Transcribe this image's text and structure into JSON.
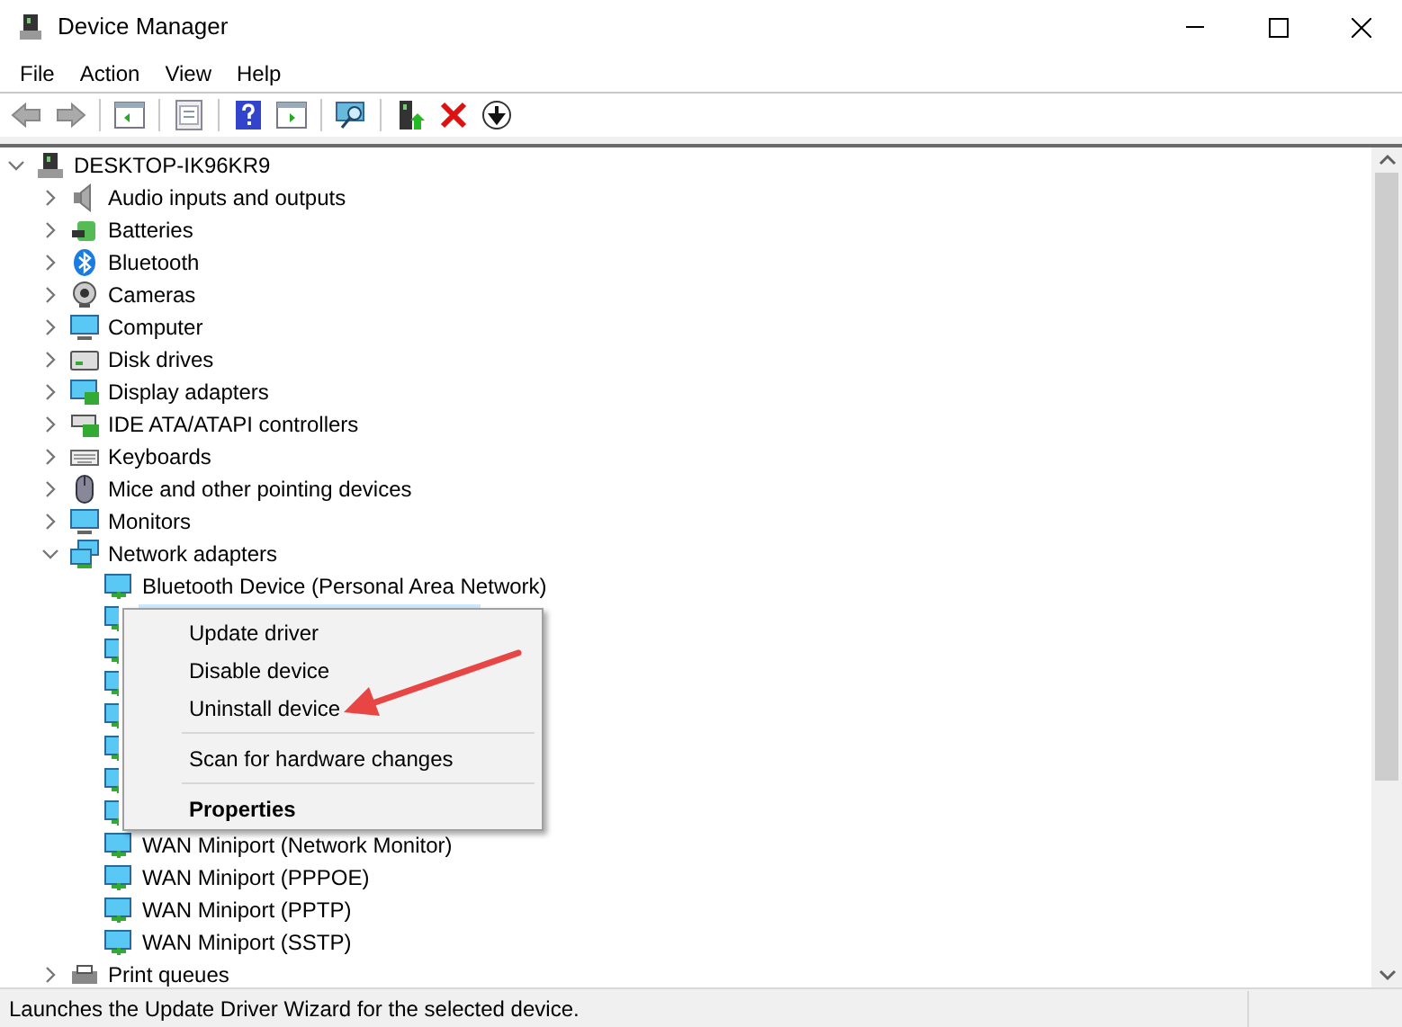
{
  "window": {
    "title": "Device Manager"
  },
  "menu_bar": [
    "File",
    "Action",
    "View",
    "Help"
  ],
  "tree": {
    "label": "DESKTOP-IK96KR9",
    "expanded": true,
    "selected": false,
    "children": [
      {
        "label": "Audio inputs and outputs",
        "expanded": false,
        "selected": false
      },
      {
        "label": "Batteries",
        "expanded": false,
        "selected": false
      },
      {
        "label": "Bluetooth",
        "expanded": false,
        "selected": false
      },
      {
        "label": "Cameras",
        "expanded": false,
        "selected": false
      },
      {
        "label": "Computer",
        "expanded": false,
        "selected": false
      },
      {
        "label": "Disk drives",
        "expanded": false,
        "selected": false
      },
      {
        "label": "Display adapters",
        "expanded": false,
        "selected": false
      },
      {
        "label": "IDE ATA/ATAPI controllers",
        "expanded": false,
        "selected": false
      },
      {
        "label": "Keyboards",
        "expanded": false,
        "selected": false
      },
      {
        "label": "Mice and other pointing devices",
        "expanded": false,
        "selected": false
      },
      {
        "label": "Monitors",
        "expanded": false,
        "selected": false
      },
      {
        "label": "Network adapters",
        "expanded": true,
        "selected": false,
        "children": [
          {
            "kind": "shown",
            "label": "Bluetooth Device (Personal Area Network)",
            "selected": false
          },
          {
            "kind": "covered",
            "selected": true
          },
          {
            "kind": "covered"
          },
          {
            "kind": "covered"
          },
          {
            "kind": "covered"
          },
          {
            "kind": "covered"
          },
          {
            "kind": "covered"
          },
          {
            "kind": "covered"
          },
          {
            "kind": "shown",
            "label": "WAN Miniport (Network Monitor)",
            "selected": false
          },
          {
            "kind": "shown",
            "label": "WAN Miniport (PPPOE)",
            "selected": false
          },
          {
            "kind": "shown",
            "label": "WAN Miniport (PPTP)",
            "selected": false
          },
          {
            "kind": "shown",
            "label": "WAN Miniport (SSTP)",
            "selected": false
          }
        ]
      },
      {
        "label": "Print queues",
        "expanded": false,
        "selected": false
      }
    ]
  },
  "context_menu": [
    {
      "kind": "item",
      "label": "Update driver",
      "default": false
    },
    {
      "kind": "item",
      "label": "Disable device",
      "default": false
    },
    {
      "kind": "item",
      "label": "Uninstall device",
      "default": false
    },
    {
      "kind": "separator"
    },
    {
      "kind": "item",
      "label": "Scan for hardware changes",
      "default": false
    },
    {
      "kind": "separator"
    },
    {
      "kind": "item",
      "label": "Properties",
      "default": true
    }
  ],
  "status_bar": "Launches the Update Driver Wizard for the selected device."
}
